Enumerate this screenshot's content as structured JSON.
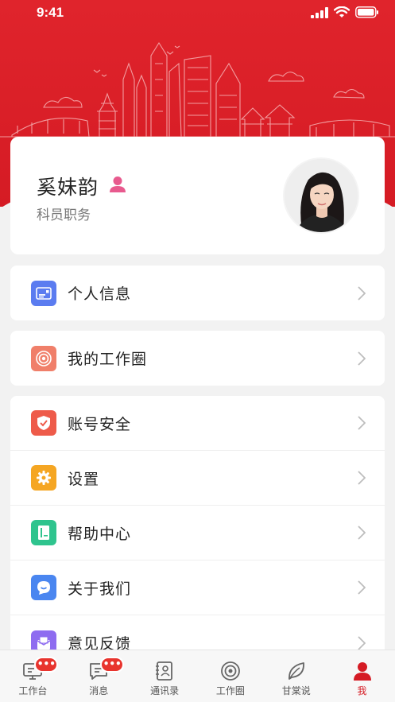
{
  "status_bar": {
    "time": "9:41"
  },
  "profile": {
    "name": "奚妹韵",
    "title": "科员职务"
  },
  "menu": {
    "personal_info": "个人信息",
    "work_circle": "我的工作圈",
    "account_security": "账号安全",
    "settings": "设置",
    "help_center": "帮助中心",
    "about_us": "关于我们",
    "feedback": "意见反馈"
  },
  "tabs": [
    {
      "label": "工作台",
      "badge": "•••"
    },
    {
      "label": "消息",
      "badge": "•••"
    },
    {
      "label": "通讯录"
    },
    {
      "label": "工作圈"
    },
    {
      "label": "甘棠说"
    },
    {
      "label": "我"
    }
  ],
  "colors": {
    "brand_red": "#d51b24",
    "badge_red": "#e8342e"
  }
}
